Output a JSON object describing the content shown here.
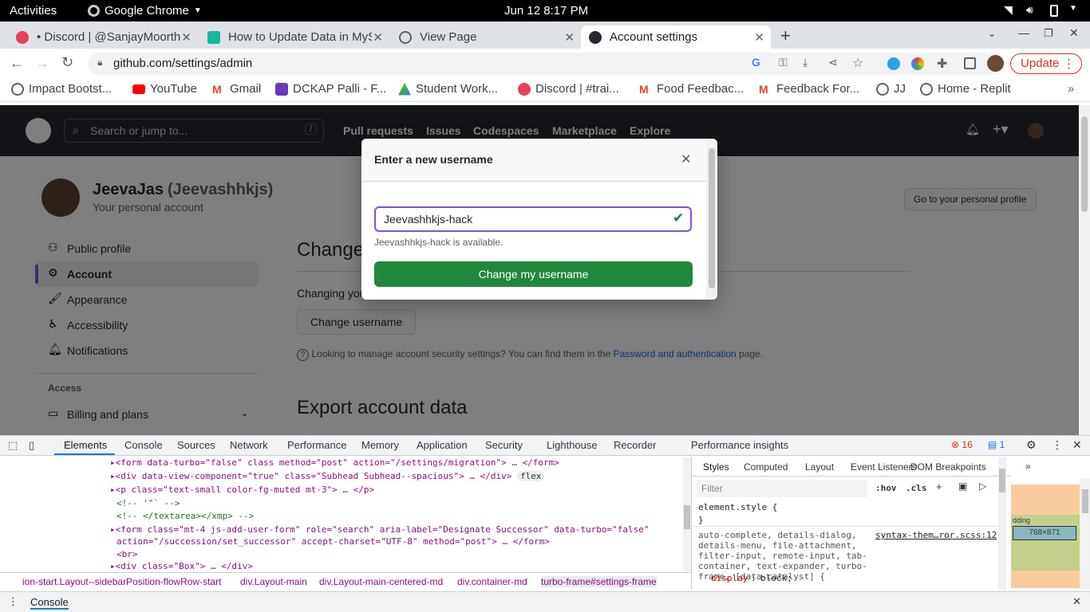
{
  "os": {
    "activities": "Activities",
    "app": "Google Chrome",
    "datetime": "Jun 12  8:17 PM"
  },
  "tabs": [
    {
      "label": "• Discord | @SanjayMoorthy",
      "active": false
    },
    {
      "label": "How to Update Data in MySQL",
      "active": false
    },
    {
      "label": "View Page",
      "active": false
    },
    {
      "label": "Account settings",
      "active": true
    }
  ],
  "address": {
    "url": "github.com/settings/admin",
    "update_label": "Update"
  },
  "bookmarks": [
    {
      "label": "Impact Bootst...",
      "icon": "globe-icon"
    },
    {
      "label": "YouTube",
      "icon": "youtube-icon"
    },
    {
      "label": "Gmail",
      "icon": "gmail-icon"
    },
    {
      "label": "DCKAP Palli - F...",
      "icon": "forms-icon"
    },
    {
      "label": "Student Work...",
      "icon": "drive-icon"
    },
    {
      "label": "Discord | #trai...",
      "icon": "discord-icon"
    },
    {
      "label": "Food Feedbac...",
      "icon": "gmail-icon"
    },
    {
      "label": "Feedback For...",
      "icon": "gmail-icon"
    },
    {
      "label": "JJ",
      "icon": "globe-icon"
    },
    {
      "label": "Home - Replit",
      "icon": "globe-icon"
    }
  ],
  "github": {
    "search_placeholder": "Search or jump to...",
    "search_key": "/",
    "nav": [
      "Pull requests",
      "Issues",
      "Codespaces",
      "Marketplace",
      "Explore"
    ],
    "user_name": "JeevaJas",
    "user_login": "(Jeevashhkjs)",
    "user_sub": "Your personal account",
    "profile_button": "Go to your personal profile",
    "sidebar": [
      {
        "label": "Public profile",
        "icon": "person-icon"
      },
      {
        "label": "Account",
        "icon": "gear-icon"
      },
      {
        "label": "Appearance",
        "icon": "paintbrush-icon"
      },
      {
        "label": "Accessibility",
        "icon": "accessibility-icon"
      },
      {
        "label": "Notifications",
        "icon": "bell-icon"
      }
    ],
    "access_heading": "Access",
    "billing": "Billing and plans",
    "change_heading": "Change",
    "changing_text": "Changing you",
    "change_button": "Change username",
    "security_text": "Looking to manage account security settings? You can find them in the",
    "security_link": "Password and authentication",
    "security_suffix": "page.",
    "export_heading": "Export account data"
  },
  "dialog": {
    "title": "Enter a new username",
    "input_value": "Jeevashhkjs-hack",
    "availability": "Jeevashhkjs-hack is available.",
    "submit": "Change my username"
  },
  "devtools": {
    "tabs": [
      "Elements",
      "Console",
      "Sources",
      "Network",
      "Performance",
      "Memory",
      "Application",
      "Security",
      "Lighthouse",
      "Recorder",
      "Performance insights"
    ],
    "error_count": "16",
    "message_count": "1",
    "code_lines": [
      "<form data-turbo=\"false\" class method=\"post\" action=\"/settings/migration\"> … </form>",
      "<div data-view-component=\"true\" class=\"Subhead Subhead--spacious\"> … </div>",
      "<p class=\"text-small color-fg-muted mt-3\"> … </p>",
      "<!-- '\"` -->",
      "<!-- </textarea></xmp> -->",
      "<form class=\"mt-4 js-add-user-form\" role=\"search\" aria-label=\"Designate Successor\" data-turbo=\"false\"",
      "action=\"/succession/set_successor\" accept-charset=\"UTF-8\" method=\"post\"> … </form>",
      "<br>",
      "<div class=\"Box\"> … </div>"
    ],
    "flex_badge": "flex",
    "breadcrumbs": [
      "ion-start.Layout--sidebarPosition-flowRow-start",
      "div.Layout-main",
      "div.Layout-main-centered-md",
      "div.container-md",
      "turbo-frame#settings-frame"
    ],
    "styles_tabs": [
      "Styles",
      "Computed",
      "Layout",
      "Event Listeners",
      "DOM Breakpoints"
    ],
    "filter_placeholder": "Filter",
    "hov": ":hov",
    "cls": ".cls",
    "element_style": "element.style {",
    "close_brace": "}",
    "rule_selector": "auto-complete, details-dialog, details-menu, file-attachment, filter-input, remote-input, tab-container, text-expander, turbo-frame, [data-catalyst] {",
    "rule_source": "syntax-them…ror.scss:12",
    "rule_prop": "display",
    "rule_value": "block;",
    "box_size": "768×871",
    "box_padding": "dding",
    "drawer_tab": "Console"
  }
}
